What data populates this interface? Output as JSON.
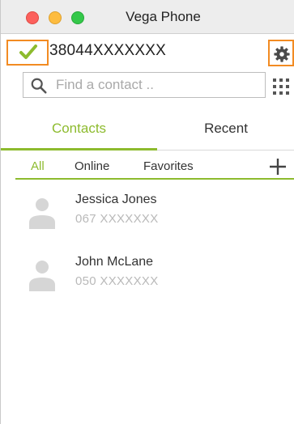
{
  "window": {
    "title": "Vega Phone"
  },
  "account": {
    "phone_number": "38044XXXXXXX",
    "status": "registered"
  },
  "search": {
    "placeholder": "Find a contact .."
  },
  "tabs": [
    {
      "label": "Contacts",
      "active": true
    },
    {
      "label": "Recent",
      "active": false
    }
  ],
  "filters": [
    {
      "label": "All",
      "active": true
    },
    {
      "label": "Online",
      "active": false
    },
    {
      "label": "Favorites",
      "active": false
    }
  ],
  "contacts": [
    {
      "name": "Jessica Jones",
      "phone": "067 XXXXXXX"
    },
    {
      "name": "John McLane",
      "phone": "050 XXXXXXX"
    }
  ],
  "colors": {
    "accent": "#8dbb2e",
    "highlight_box": "#f28b22",
    "muted_text": "#b9b9b9"
  },
  "icons": {
    "status": "check-icon",
    "settings": "gear-icon",
    "search": "search-icon",
    "dialpad": "dialpad-icon",
    "add": "add-icon",
    "avatar": "person-icon"
  }
}
